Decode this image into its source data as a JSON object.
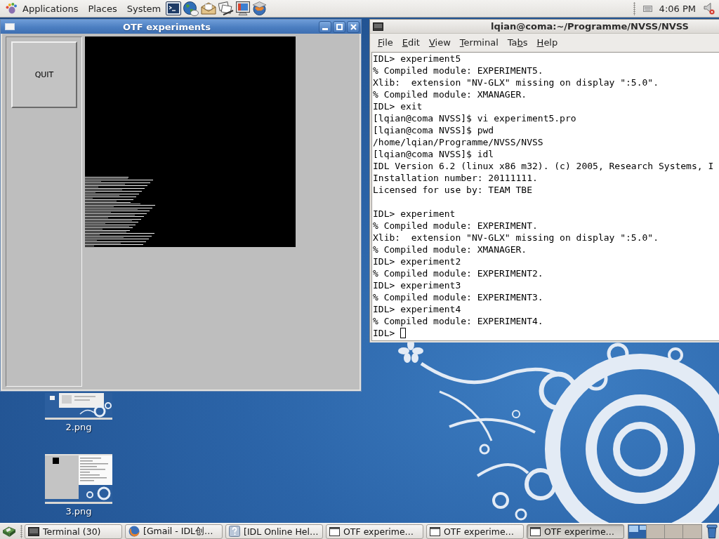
{
  "top_panel": {
    "menus": [
      "Applications",
      "Places",
      "System"
    ],
    "clock": "4:06 PM"
  },
  "otf_window": {
    "title": "OTF experiments",
    "active": true,
    "quit_button": "QUIT"
  },
  "terminal_window": {
    "title": "lqian@coma:~/Programme/NVSS/NVSS",
    "active": false,
    "menu": [
      {
        "access_key": "F",
        "label_end": "ile"
      },
      {
        "access_key": "E",
        "label_end": "dit"
      },
      {
        "access_key": "V",
        "label_end": "iew"
      },
      {
        "access_key": "T",
        "label_end": "erminal"
      },
      {
        "label_start": "Ta",
        "access_key": "b",
        "label_end": "s"
      },
      {
        "access_key": "H",
        "label_end": "elp"
      }
    ],
    "output_blocks": [
      {
        "lines": [
          "IDL> experiment5",
          "% Compiled module: EXPERIMENT5.",
          "Xlib:  extension \"NV-GLX\" missing on display \":5.0\".",
          "% Compiled module: XMANAGER.",
          "IDL> exit",
          "[lqian@coma NVSS]$ vi experiment5.pro",
          "[lqian@coma NVSS]$ pwd",
          "/home/lqian/Programme/NVSS/NVSS",
          "[lqian@coma NVSS]$ idl",
          "IDL Version 6.2 (linux x86 m32). (c) 2005, Research Systems, I",
          "Installation number: 20111111.",
          "Licensed for use by: TEAM TBE"
        ]
      },
      {
        "lines": [
          "IDL> experiment",
          "% Compiled module: EXPERIMENT.",
          "Xlib:  extension \"NV-GLX\" missing on display \":5.0\".",
          "% Compiled module: XMANAGER.",
          "IDL> experiment2",
          "% Compiled module: EXPERIMENT2.",
          "IDL> experiment3",
          "% Compiled module: EXPERIMENT3.",
          "IDL> experiment4",
          "% Compiled module: EXPERIMENT4."
        ]
      }
    ],
    "prompt": "IDL>"
  },
  "desktop_icons": [
    {
      "label": "2.png",
      "kind": "desktop"
    },
    {
      "label": "3.png",
      "kind": "windows"
    }
  ],
  "taskbar": {
    "tasks": [
      {
        "label": "Terminal (30)",
        "kind": "terminal",
        "selected": false
      },
      {
        "label": "[Gmail - IDL创…",
        "kind": "browser",
        "selected": false
      },
      {
        "label": "[IDL Online Hel…",
        "kind": "help",
        "selected": false
      },
      {
        "label": "OTF experime…",
        "kind": "window",
        "selected": false
      },
      {
        "label": "OTF experime…",
        "kind": "window",
        "selected": false
      },
      {
        "label": "OTF experime…",
        "kind": "window",
        "selected": true
      }
    ],
    "workspaces": [
      {
        "selected": true
      },
      {
        "selected": false
      },
      {
        "selected": false
      },
      {
        "selected": false
      }
    ]
  }
}
